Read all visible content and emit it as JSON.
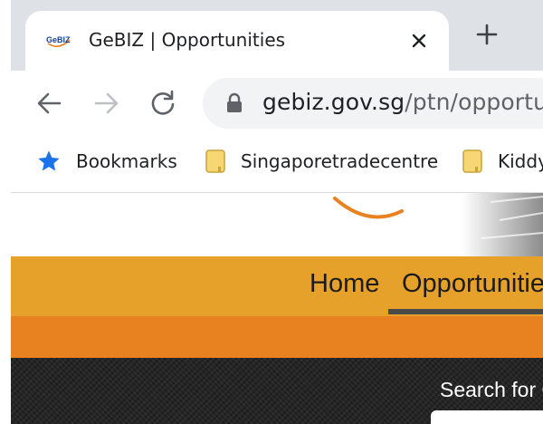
{
  "browser": {
    "tab": {
      "title": "GeBIZ | Opportunities",
      "favicon_text": "GeBIZ"
    },
    "url": {
      "host": "gebiz.gov.sg",
      "path": "/ptn/opportu"
    },
    "bookmarks": [
      {
        "label": "Bookmarks",
        "icon": "star-icon"
      },
      {
        "label": "Singaporetradecentre",
        "icon": "folder-icon"
      },
      {
        "label": "Kiddy",
        "icon": "folder-icon"
      }
    ]
  },
  "site": {
    "nav": {
      "items": [
        "Home",
        "Opportunities"
      ],
      "active": "Opportunities"
    },
    "search_label": "Search for O"
  },
  "colors": {
    "tab_strip": "#dee1e6",
    "navbar": "#e6a12a",
    "orange_strip": "#e8811f",
    "dark_section": "#252525",
    "bookmark_star": "#1a73e8",
    "folder": "#f7d774"
  }
}
